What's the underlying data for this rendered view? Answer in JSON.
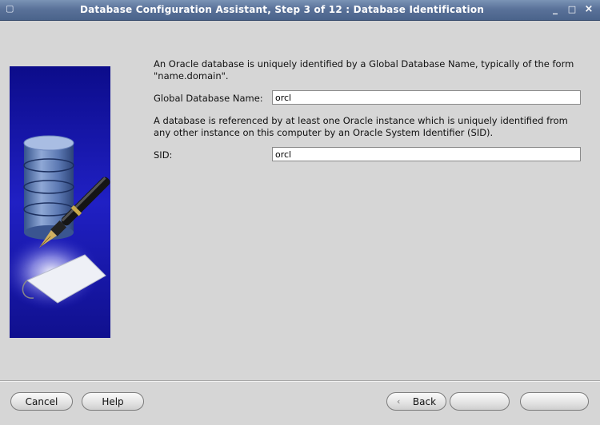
{
  "window": {
    "title": "Database Configuration Assistant, Step 3 of 12 : Database Identification",
    "min_glyph": "_",
    "max_glyph": "□",
    "close_glyph": "×"
  },
  "main": {
    "intro_text": "An Oracle database is uniquely identified by a Global Database Name, typically of the form \"name.domain\".",
    "global_db_name_label": "Global Database Name:",
    "global_db_name_value": "orcl",
    "sid_text": "A database is referenced by at least one Oracle instance which is uniquely identified from any other instance on this computer by an Oracle System Identifier (SID).",
    "sid_label": "SID:",
    "sid_value": "orcl"
  },
  "buttons": {
    "cancel": "Cancel",
    "help": "Help",
    "back": "Back",
    "back_arrow": "‹"
  },
  "colors": {
    "titlebar": "#5a7299",
    "panel_background": "#d6d6d6",
    "art_background": "#1a1aa6"
  }
}
